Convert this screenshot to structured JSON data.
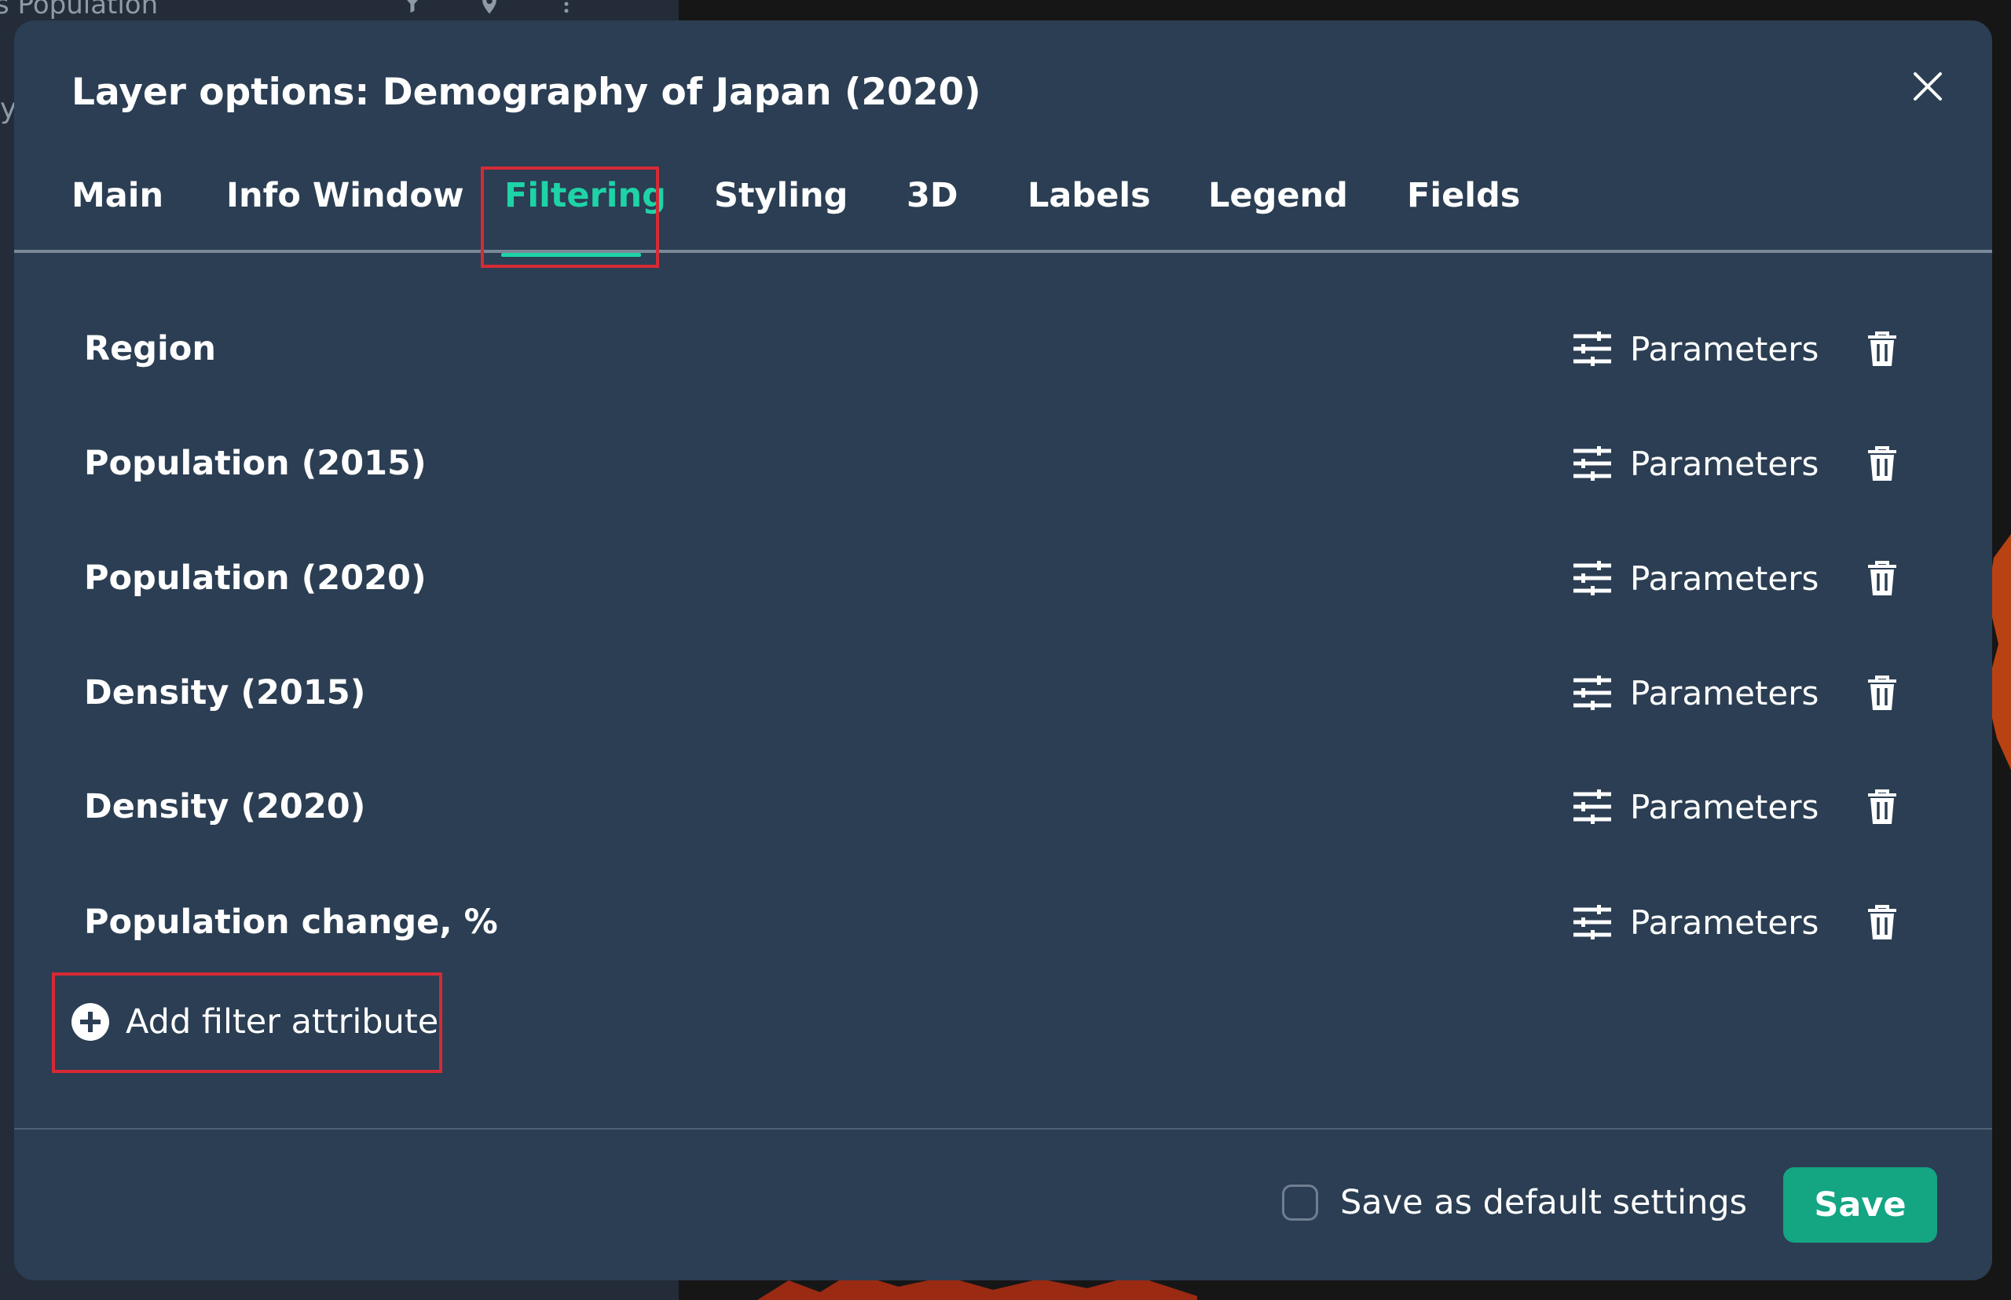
{
  "background": {
    "panel_title": "s Population"
  },
  "modal": {
    "title": "Layer options: Demography of Japan (2020)",
    "tabs": [
      {
        "label": "Main",
        "active": false
      },
      {
        "label": "Info Window",
        "active": false
      },
      {
        "label": "Filtering",
        "active": true
      },
      {
        "label": "Styling",
        "active": false
      },
      {
        "label": "3D",
        "active": false
      },
      {
        "label": "Labels",
        "active": false
      },
      {
        "label": "Legend",
        "active": false
      },
      {
        "label": "Fields",
        "active": false
      }
    ],
    "filters": [
      {
        "name": "Region",
        "params_label": "Parameters"
      },
      {
        "name": "Population (2015)",
        "params_label": "Parameters"
      },
      {
        "name": "Population (2020)",
        "params_label": "Parameters"
      },
      {
        "name": "Density (2015)",
        "params_label": "Parameters"
      },
      {
        "name": "Density (2020)",
        "params_label": "Parameters"
      },
      {
        "name": "Population change, %",
        "params_label": "Parameters"
      }
    ],
    "add_filter_label": "Add filter attribute",
    "save_default_label": "Save as default settings",
    "save_default_checked": false,
    "save_label": "Save"
  },
  "icons": {
    "close": "close-icon",
    "parameters": "sliders-icon",
    "delete": "trash-icon",
    "add": "plus-circle-icon",
    "filter": "filter-icon",
    "location": "location-pin-icon",
    "more": "more-vertical-icon"
  },
  "colors": {
    "modal_bg": "#2b3e53",
    "accent": "#1ed3a7",
    "save_button": "#14a583",
    "annotation_box": "#d62a36"
  }
}
